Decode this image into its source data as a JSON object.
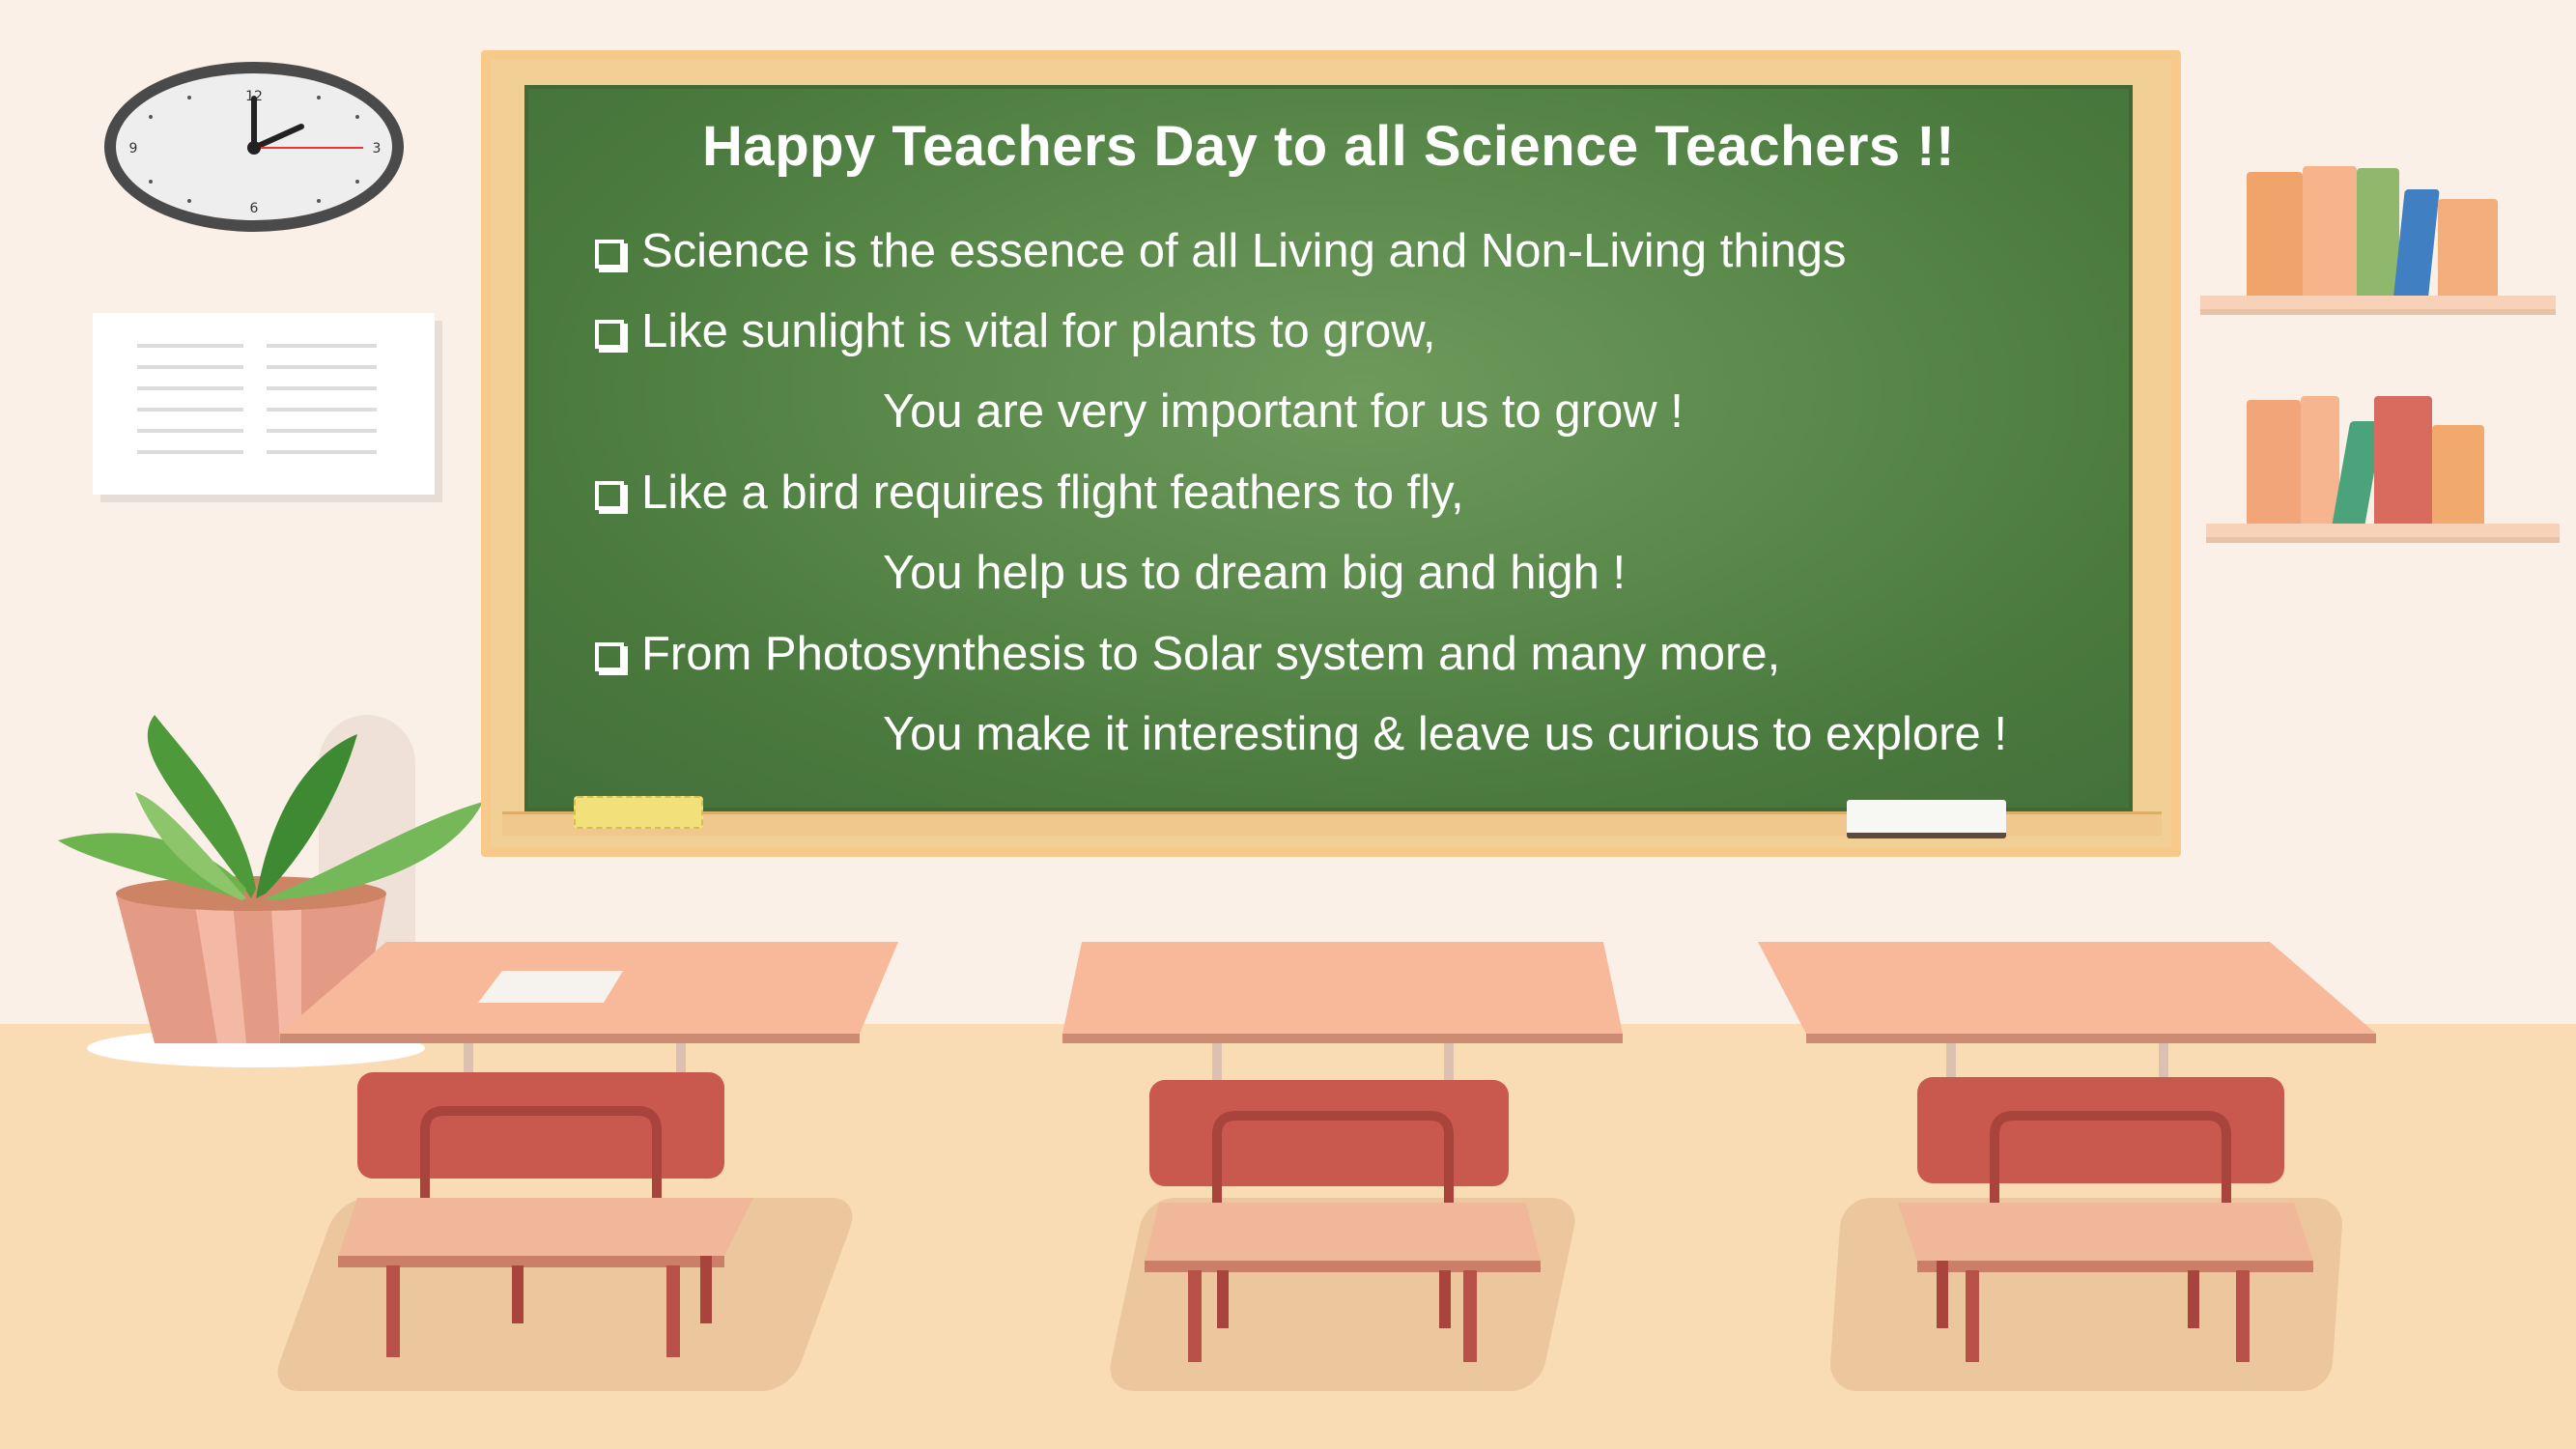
{
  "board": {
    "title": "Happy Teachers Day to all Science Teachers !!",
    "lines": [
      {
        "bullet": true,
        "text": "Science is the essence of all Living and Non-Living things"
      },
      {
        "bullet": true,
        "text": "Like sunlight is vital for plants to grow,"
      },
      {
        "bullet": false,
        "text": "You are very important for us to grow !"
      },
      {
        "bullet": true,
        "text": "Like a bird requires flight feathers to fly,"
      },
      {
        "bullet": false,
        "text": "You help us to dream big and high !"
      },
      {
        "bullet": true,
        "text": "From Photosynthesis to Solar system and many more,"
      },
      {
        "bullet": false,
        "text": "You make it interesting & leave us curious to explore !"
      }
    ]
  },
  "colors": {
    "board_green": "#4b7a3e",
    "frame": "#f7c98a",
    "wall": "#fbf0e8",
    "floor": "#f9dcb4",
    "chair": "#c9584e",
    "desk": "#f7b99a"
  },
  "icons": [
    "clock-icon",
    "checkbox-icon",
    "plant-icon",
    "book-icon"
  ]
}
